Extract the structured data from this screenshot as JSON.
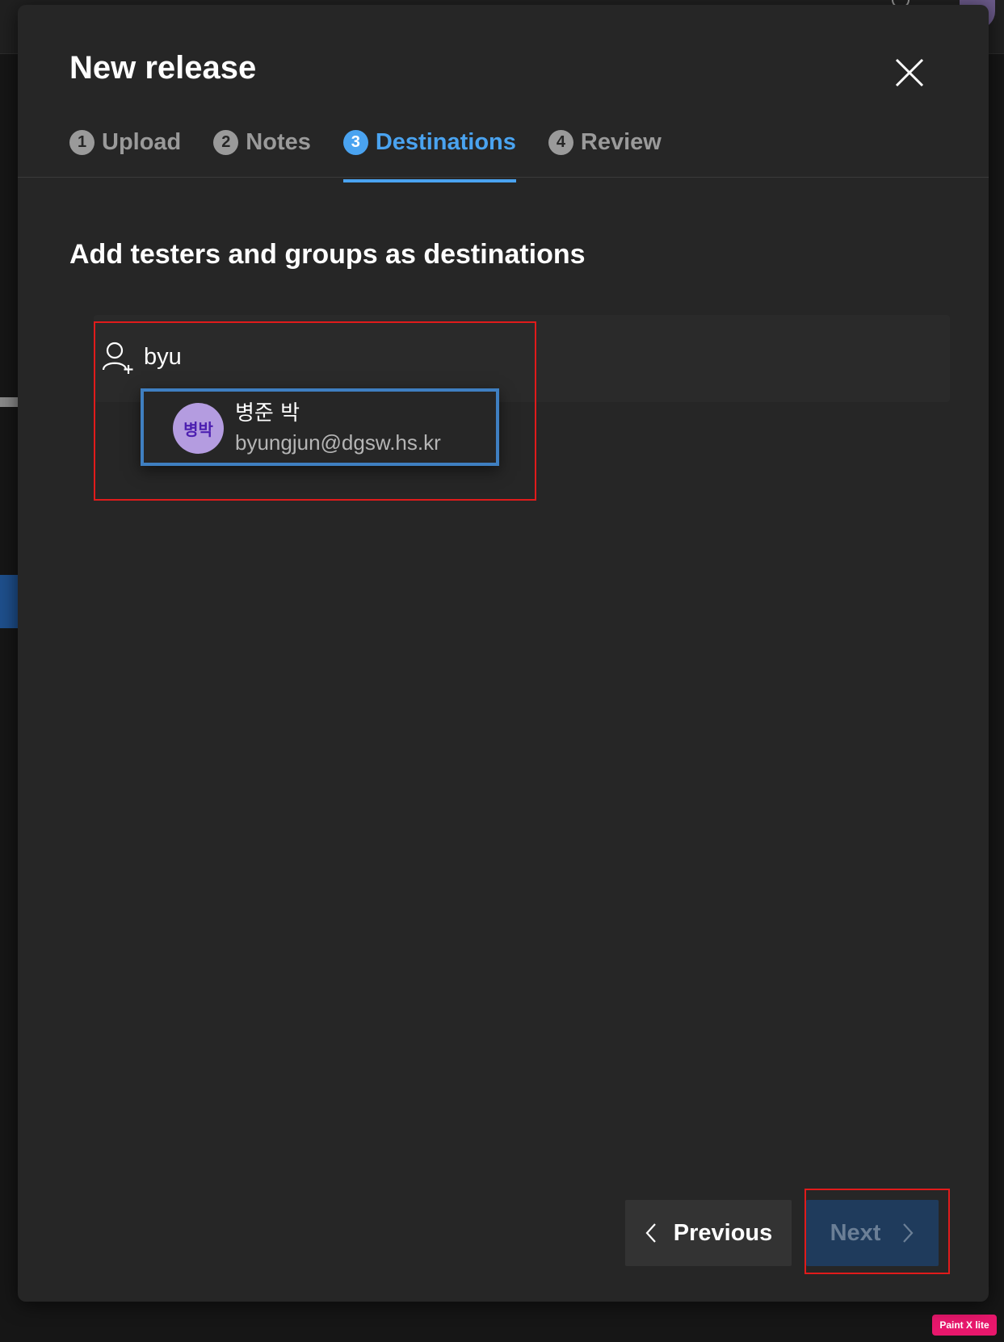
{
  "dialog": {
    "title": "New release",
    "close_icon": "close-icon"
  },
  "steps": [
    {
      "number": "1",
      "label": "Upload",
      "state": "inactive"
    },
    {
      "number": "2",
      "label": "Notes",
      "state": "inactive"
    },
    {
      "number": "3",
      "label": "Destinations",
      "state": "active"
    },
    {
      "number": "4",
      "label": "Review",
      "state": "inactive"
    }
  ],
  "section": {
    "heading": "Add testers and groups as destinations"
  },
  "search": {
    "icon": "add-user-icon",
    "value": "byu"
  },
  "suggestion": {
    "avatar_initials": "병박",
    "name": "병준 박",
    "email": "byungjun@dgsw.hs.kr"
  },
  "footer": {
    "previous_label": "Previous",
    "next_label": "Next",
    "next_enabled": false
  },
  "colors": {
    "accent": "#4aa3f0",
    "dialog_bg": "#262626",
    "annotation_red": "#e01b1b",
    "selection_blue": "#3f7fc1",
    "avatar_bg": "#b49ce0"
  },
  "overlay_badge": "Paint X lite"
}
